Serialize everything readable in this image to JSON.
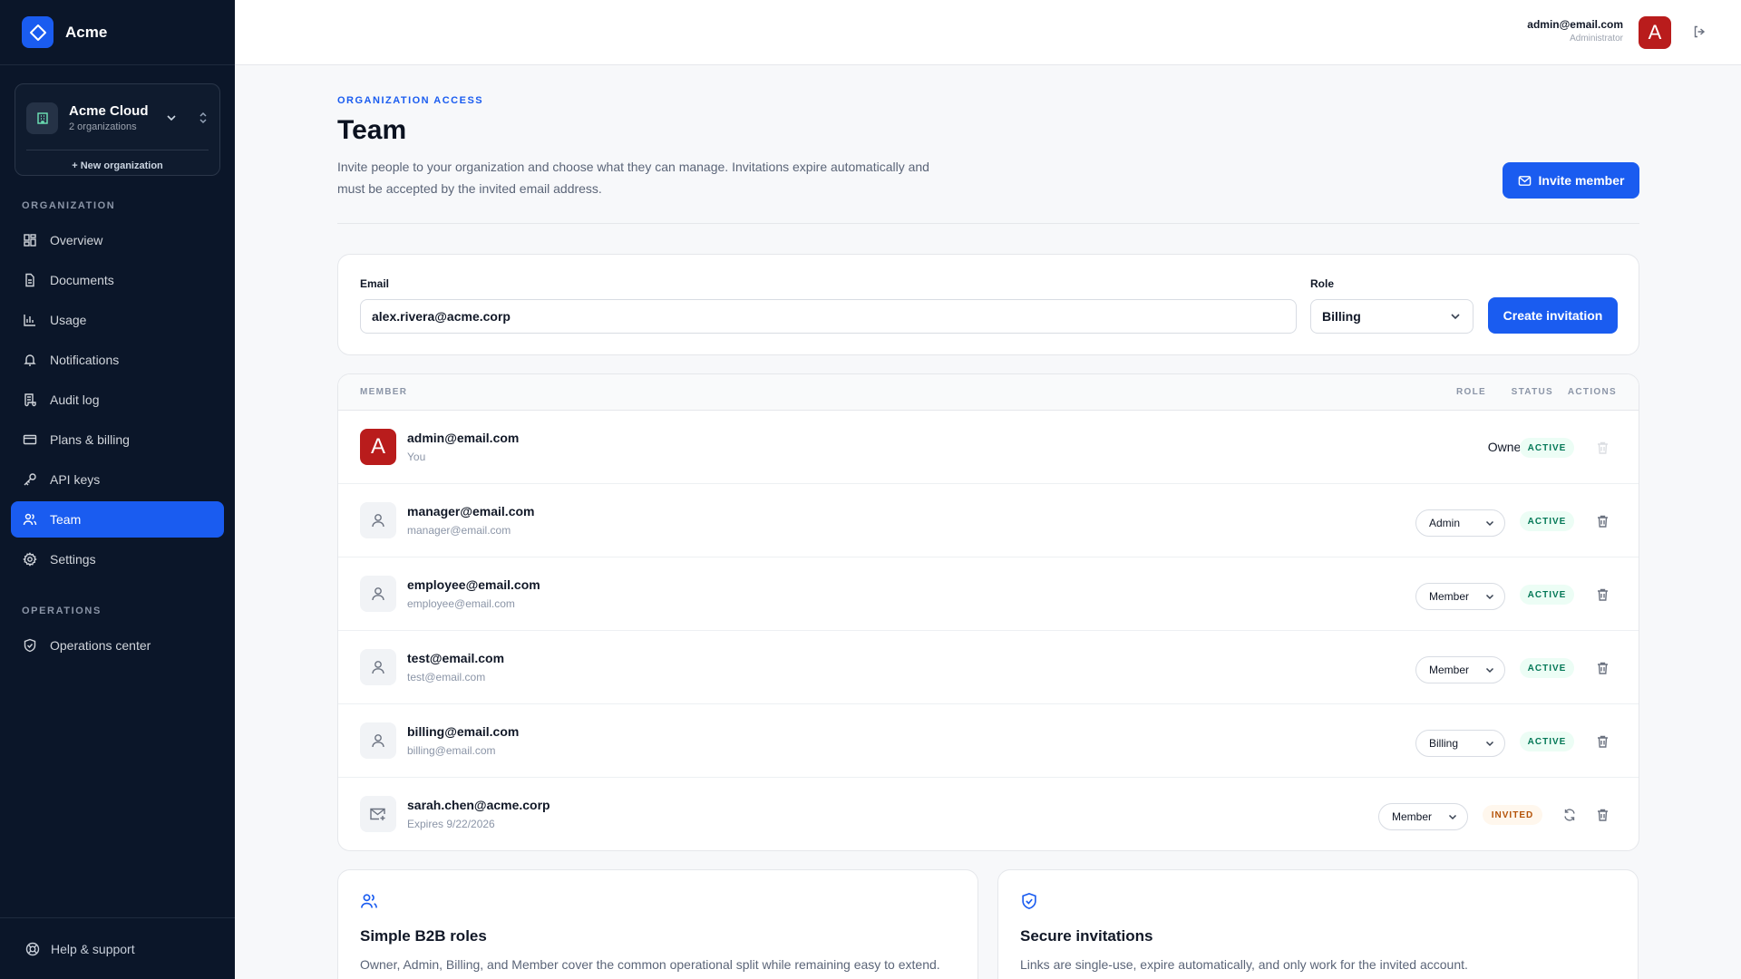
{
  "app": {
    "name": "Acme"
  },
  "org": {
    "name": "Acme Cloud",
    "sub": "2 organizations",
    "new_label": "+ New organization"
  },
  "nav": {
    "section_org": "ORGANIZATION",
    "section_ops": "OPERATIONS",
    "items": [
      {
        "label": "Overview",
        "icon": "grid-icon"
      },
      {
        "label": "Documents",
        "icon": "document-icon"
      },
      {
        "label": "Usage",
        "icon": "bar-chart-icon"
      },
      {
        "label": "Notifications",
        "icon": "bell-icon"
      },
      {
        "label": "Audit log",
        "icon": "scroll-icon"
      },
      {
        "label": "Plans & billing",
        "icon": "credit-card-icon"
      },
      {
        "label": "API keys",
        "icon": "key-icon"
      },
      {
        "label": "Team",
        "icon": "users-icon",
        "active": true
      },
      {
        "label": "Settings",
        "icon": "gear-icon"
      }
    ],
    "ops_items": [
      {
        "label": "Operations center",
        "icon": "shield-icon"
      }
    ],
    "help": "Help & support"
  },
  "header": {
    "email": "admin@email.com",
    "role": "Administrator",
    "avatar_letter": "A"
  },
  "page": {
    "eyebrow": "ORGANIZATION ACCESS",
    "title": "Team",
    "description": "Invite people to your organization and choose what they can manage. Invitations expire automatically and must be accepted by the invited email address.",
    "invite_button": "Invite member"
  },
  "form": {
    "email_label": "Email",
    "email_value": "alex.rivera@acme.corp",
    "role_label": "Role",
    "role_value": "Billing",
    "create_button": "Create invitation"
  },
  "table": {
    "headers": {
      "member": "MEMBER",
      "role": "ROLE",
      "status": "STATUS",
      "actions": "ACTIONS"
    },
    "rows": [
      {
        "title": "admin@email.com",
        "sub": "You",
        "role": "Owner",
        "status": "ACTIVE",
        "avatar": "A"
      },
      {
        "title": "manager@email.com",
        "sub": "manager@email.com",
        "role": "Admin",
        "status": "ACTIVE"
      },
      {
        "title": "employee@email.com",
        "sub": "employee@email.com",
        "role": "Member",
        "status": "ACTIVE"
      },
      {
        "title": "test@email.com",
        "sub": "test@email.com",
        "role": "Member",
        "status": "ACTIVE"
      },
      {
        "title": "billing@email.com",
        "sub": "billing@email.com",
        "role": "Billing",
        "status": "ACTIVE"
      },
      {
        "title": "sarah.chen@acme.corp",
        "sub": "Expires 9/22/2026",
        "role": "Member",
        "status": "INVITED"
      }
    ]
  },
  "cards": [
    {
      "title": "Simple B2B roles",
      "desc": "Owner, Admin, Billing, and Member cover the common operational split while remaining easy to extend."
    },
    {
      "title": "Secure invitations",
      "desc": "Links are single-use, expire automatically, and only work for the invited account."
    }
  ],
  "colors": {
    "accent": "#1a5cf0",
    "sidebar": "#0b1629",
    "avatar": "#b91c1c",
    "active_badge": "#047857",
    "invited_badge": "#b45309"
  }
}
